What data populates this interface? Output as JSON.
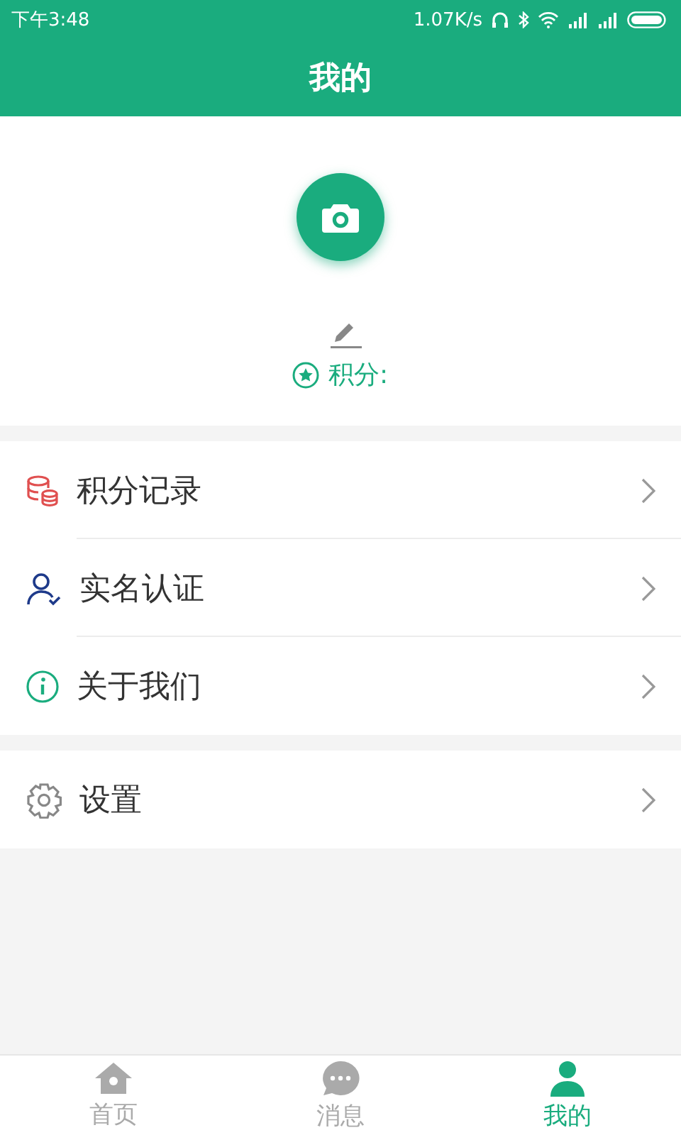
{
  "status_bar": {
    "time": "下午3:48",
    "speed": "1.07K/s"
  },
  "header": {
    "title": "我的"
  },
  "profile": {
    "points_label": "积分:"
  },
  "menu_groups": [
    [
      {
        "kind": "coins",
        "label": "积分记录"
      },
      {
        "kind": "user",
        "label": "实名认证"
      },
      {
        "kind": "info",
        "label": "关于我们"
      }
    ],
    [
      {
        "kind": "gear",
        "label": "设置"
      }
    ]
  ],
  "tabs": [
    {
      "kind": "home",
      "label": "首页",
      "selected": false
    },
    {
      "kind": "chat",
      "label": "消息",
      "selected": false
    },
    {
      "kind": "person",
      "label": "我的",
      "selected": true
    }
  ]
}
